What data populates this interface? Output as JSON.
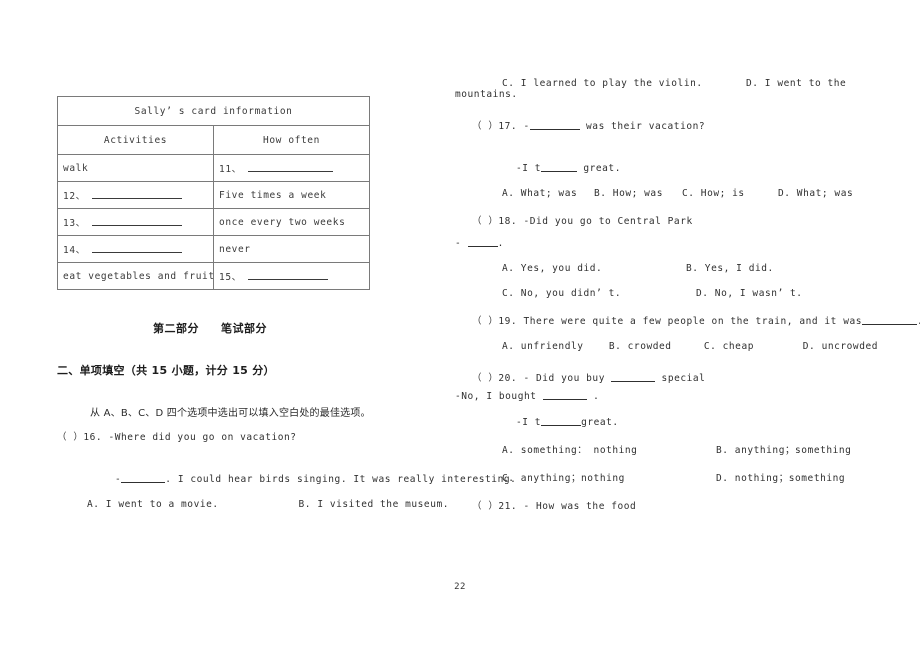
{
  "page": {
    "number": "22"
  },
  "table": {
    "title": "Sally’ s card information",
    "headers": [
      "Activities",
      "How often"
    ],
    "rows": [
      {
        "activity": "walk",
        "activity_blank": false,
        "how_often": "11、",
        "how_often_blank": true
      },
      {
        "activity": "12、",
        "activity_blank": true,
        "how_often": "Five times a week",
        "how_often_blank": false
      },
      {
        "activity": "13、",
        "activity_blank": true,
        "how_often": "once every two weeks",
        "how_often_blank": false
      },
      {
        "activity": "14、",
        "activity_blank": true,
        "how_often": "never",
        "how_often_blank": false
      },
      {
        "activity": "eat vegetables and fruit",
        "activity_blank": false,
        "how_often": "15、",
        "how_often_blank": true
      }
    ]
  },
  "headings": {
    "part_two": "第二部分",
    "part_two_sub": "笔试部分",
    "section_two": "二、单项填空（共 15 小题，计分 15 分）",
    "instruction": "从 A、B、C、D 四个选项中选出可以填入空白处的最佳选项。"
  },
  "left_column": {
    "q16": {
      "marker": "（ ）16.",
      "stem": "-Where did you go on vacation?",
      "answer_prefix": "-",
      "answer_suffix": ". I could hear birds singing. It was really interesting.",
      "option_a": "A. I went to a movie.",
      "option_b": "B. I visited the museum."
    }
  },
  "right_column": {
    "q16_cont": {
      "option_c": "C. I learned to play the violin.",
      "option_d": "D. I went to the",
      "option_d_wrap": "mountains."
    },
    "q17": {
      "marker": "（ ）17.",
      "stem_prefix": "-",
      "stem_suffix": "was their vacation?",
      "answer_prefix": "-I t",
      "answer_suffix": "great.",
      "option_a": "A. What; was",
      "option_b": "B. How; was",
      "option_c": "C. How; is",
      "option_d": "D. What; was"
    },
    "q18": {
      "marker": "（ ）18.",
      "stem": "-Did you go to Central Park",
      "answer_prefix": "-",
      "answer_suffix": ".",
      "option_a": "A. Yes, you did.",
      "option_b": "B. Yes, I did.",
      "option_c": "C. No, you didn’ t.",
      "option_d": "D. No, I wasn’ t."
    },
    "q19": {
      "marker": "（ ）19.",
      "stem_prefix": "There were quite a few people on the train, and it was",
      "stem_suffix": ".",
      "option_a": "A. unfriendly",
      "option_b": "B. crowded",
      "option_c": "C. cheap",
      "option_d": "D. uncrowded"
    },
    "q20": {
      "marker": "（ ）20.",
      "stem_prefix": "- Did you buy",
      "stem_suffix": "special",
      "reply_prefix": "-No, I bought",
      "reply_suffix": ".",
      "answer_prefix": "-I t",
      "answer_suffix": "great.",
      "option_a": "A. something： nothing",
      "option_b": "B. anything；something",
      "option_c": "C. anything；nothing",
      "option_d": "D. nothing；something"
    },
    "q21": {
      "marker": "（ ）21.",
      "stem": "- How was the food"
    }
  }
}
